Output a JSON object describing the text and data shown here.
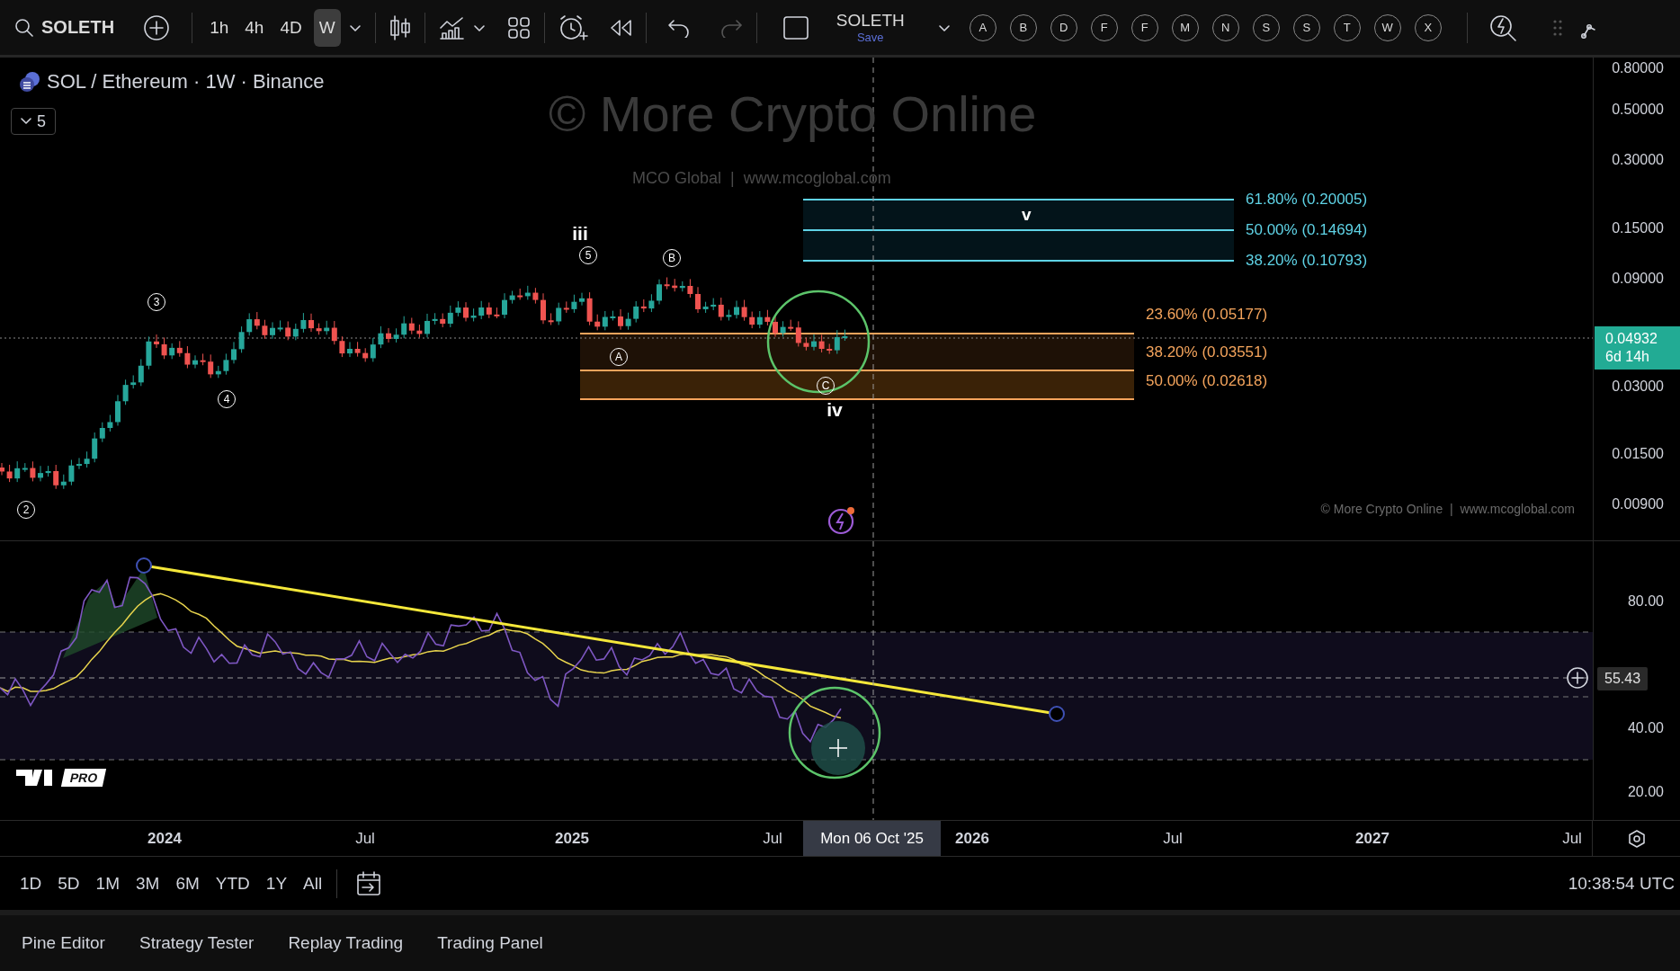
{
  "toolbar": {
    "symbol": "SOLETH",
    "intervals": [
      {
        "label": "1h",
        "selected": false
      },
      {
        "label": "4h",
        "selected": false
      },
      {
        "label": "4D",
        "selected": false
      },
      {
        "label": "W",
        "selected": true
      }
    ],
    "layout": {
      "name": "SOLETH",
      "action": "Save"
    },
    "watchlist": [
      "A",
      "B",
      "D",
      "F",
      "F",
      "M",
      "N",
      "S",
      "S",
      "T",
      "W",
      "X"
    ]
  },
  "chart": {
    "title": "SOL / Ethereum · 1W · Binance",
    "collapse_count": "5",
    "watermark": {
      "title": "© More Crypto Online",
      "subtitle": "MCO Global  |  www.mcoglobal.com"
    },
    "footer_note": "© More Crypto Online  |  www.mcoglobal.com",
    "wave_labels": [
      {
        "text": "3",
        "kind": "circled"
      },
      {
        "text": "4",
        "kind": "circled"
      },
      {
        "text": "2",
        "kind": "circled"
      },
      {
        "text": "iii",
        "kind": "plain"
      },
      {
        "text": "5",
        "kind": "circled"
      },
      {
        "text": "B",
        "kind": "circled"
      },
      {
        "text": "A",
        "kind": "circled"
      },
      {
        "text": "C",
        "kind": "circled"
      },
      {
        "text": "iv",
        "kind": "plain"
      }
    ],
    "target_zone": {
      "label": "v",
      "levels": [
        "61.80% (0.20005)",
        "50.00% (0.14694)",
        "38.20% (0.10793)"
      ]
    },
    "support_zone": {
      "levels": [
        "23.60% (0.05177)",
        "38.20% (0.03551)",
        "50.00% (0.02618)"
      ]
    },
    "price_axis": [
      "0.80000",
      "0.50000",
      "0.30000",
      "0.15000",
      "0.09000",
      "0.03000",
      "0.01500",
      "0.00900"
    ],
    "last_price": {
      "price": "0.04932",
      "countdown": "6d 14h"
    }
  },
  "rsi": {
    "axis": [
      "80.00",
      "40.00",
      "20.00"
    ],
    "crosshair_value": "55.43",
    "logo_badge": "PRO"
  },
  "time_axis": {
    "labels": [
      "2024",
      "Jul",
      "2025",
      "Jul",
      "2026",
      "Jul",
      "2027",
      "Jul"
    ],
    "crosshair_date": "Mon 06 Oct '25"
  },
  "ranges": [
    "1D",
    "5D",
    "1M",
    "3M",
    "6M",
    "YTD",
    "1Y",
    "All"
  ],
  "clock": "10:38:54 UTC",
  "bottom_tabs": [
    "Pine Editor",
    "Strategy Tester",
    "Replay Trading",
    "Trading Panel"
  ]
}
